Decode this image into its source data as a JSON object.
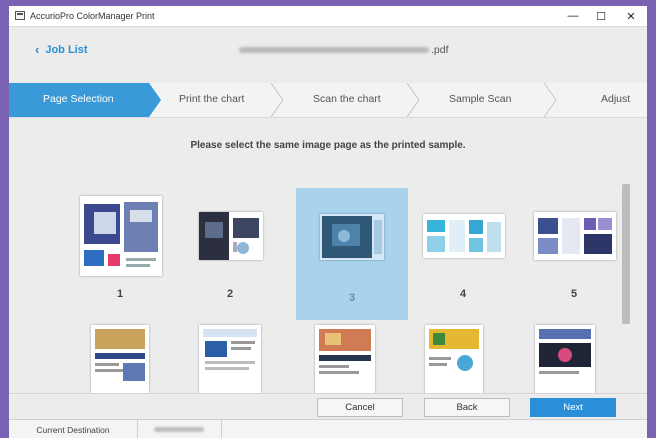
{
  "window": {
    "title": "AccurioPro ColorManager Print",
    "minimize_glyph": "—",
    "maximize_glyph": "☐",
    "close_glyph": "✕"
  },
  "header": {
    "back_label": "Job List",
    "back_icon": "chevron-left-icon",
    "file_suffix": ".pdf"
  },
  "steps": [
    {
      "label": "Page Selection",
      "active": true
    },
    {
      "label": "Print the chart",
      "active": false
    },
    {
      "label": "Scan the chart",
      "active": false
    },
    {
      "label": "Sample Scan",
      "active": false
    },
    {
      "label": "Adjust",
      "active": false
    }
  ],
  "instruction": "Please select the same image page as the printed sample.",
  "pages": [
    {
      "number": "1",
      "selected": false
    },
    {
      "number": "2",
      "selected": false
    },
    {
      "number": "3",
      "selected": true
    },
    {
      "number": "4",
      "selected": false
    },
    {
      "number": "5",
      "selected": false
    }
  ],
  "buttons": {
    "cancel": "Cancel",
    "back": "Back",
    "next": "Next"
  },
  "status": {
    "label": "Current Destination"
  },
  "colors": {
    "accent": "#2a8fd8",
    "step_active": "#3a9ad9",
    "selected_tile": "#a9d3ec",
    "background": "#7a63b5"
  }
}
